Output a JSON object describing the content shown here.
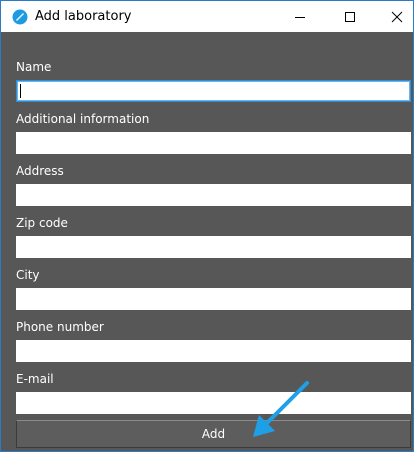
{
  "window": {
    "title": "Add laboratory",
    "accent_color": "#2d7bc6",
    "icon": "app-logo-icon",
    "controls": {
      "minimize_icon": "minimize-icon",
      "maximize_icon": "maximize-icon",
      "close_icon": "close-icon"
    }
  },
  "form": {
    "background_color": "#575757",
    "fields": [
      {
        "label": "Name",
        "value": "",
        "focused": true
      },
      {
        "label": "Additional information",
        "value": ""
      },
      {
        "label": "Address",
        "value": ""
      },
      {
        "label": "Zip code",
        "value": ""
      },
      {
        "label": "City",
        "value": ""
      },
      {
        "label": "Phone number",
        "value": ""
      },
      {
        "label": "E-mail",
        "value": ""
      }
    ],
    "submit_label": "Add"
  },
  "annotation": {
    "icon": "pointer-arrow-icon",
    "color": "#1ea0e6"
  }
}
